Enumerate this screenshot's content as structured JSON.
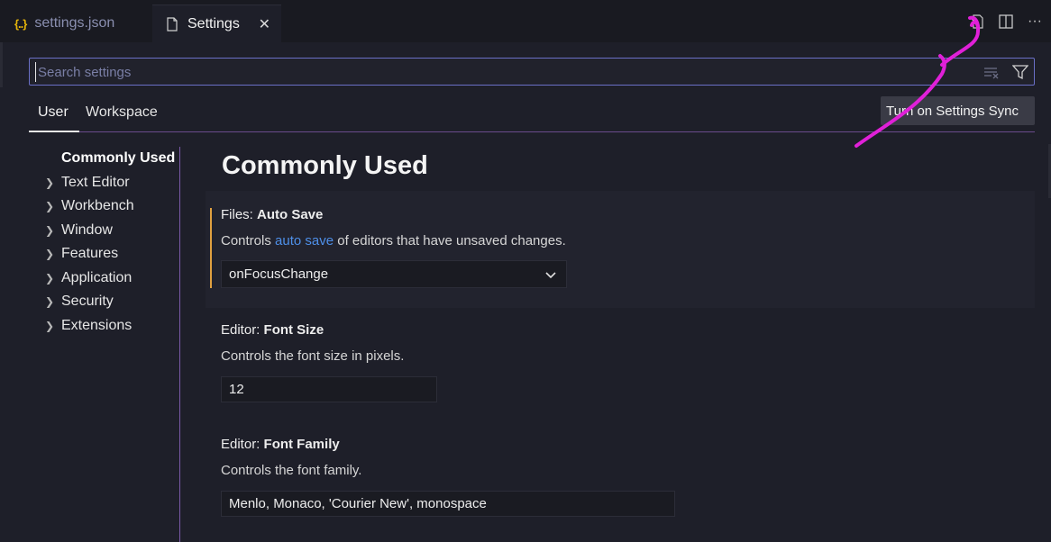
{
  "tabs": {
    "json_icon": "{..}",
    "json_label": "settings.json",
    "settings_label": "Settings",
    "close_glyph": "✕"
  },
  "editor_actions": {
    "open_json_icon": "open-settings-json-icon",
    "split_icon": "split-editor-icon",
    "more_glyph": "···"
  },
  "search": {
    "placeholder": "Search settings",
    "value": ""
  },
  "scopes": {
    "user": "User",
    "workspace": "Workspace",
    "sync_button": "Turn on Settings Sync"
  },
  "toc": {
    "items": [
      {
        "label": "Commonly Used",
        "active": true
      },
      {
        "label": "Text Editor"
      },
      {
        "label": "Workbench"
      },
      {
        "label": "Window"
      },
      {
        "label": "Features"
      },
      {
        "label": "Application"
      },
      {
        "label": "Security"
      },
      {
        "label": "Extensions"
      }
    ]
  },
  "main": {
    "section_title": "Commonly Used",
    "settings": [
      {
        "category": "Files: ",
        "name": "Auto Save",
        "desc_before": "Controls ",
        "desc_link": "auto save",
        "desc_after": " of editors that have unsaved changes.",
        "value": "onFocusChange"
      },
      {
        "category": "Editor: ",
        "name": "Font Size",
        "desc": "Controls the font size in pixels.",
        "value": "12"
      },
      {
        "category": "Editor: ",
        "name": "Font Family",
        "desc": "Controls the font family.",
        "value": "Menlo, Monaco, 'Courier New', monospace"
      }
    ]
  },
  "colors": {
    "accent_modified": "#e0a040",
    "link": "#4e8fe8",
    "annotation": "#e020d8"
  }
}
